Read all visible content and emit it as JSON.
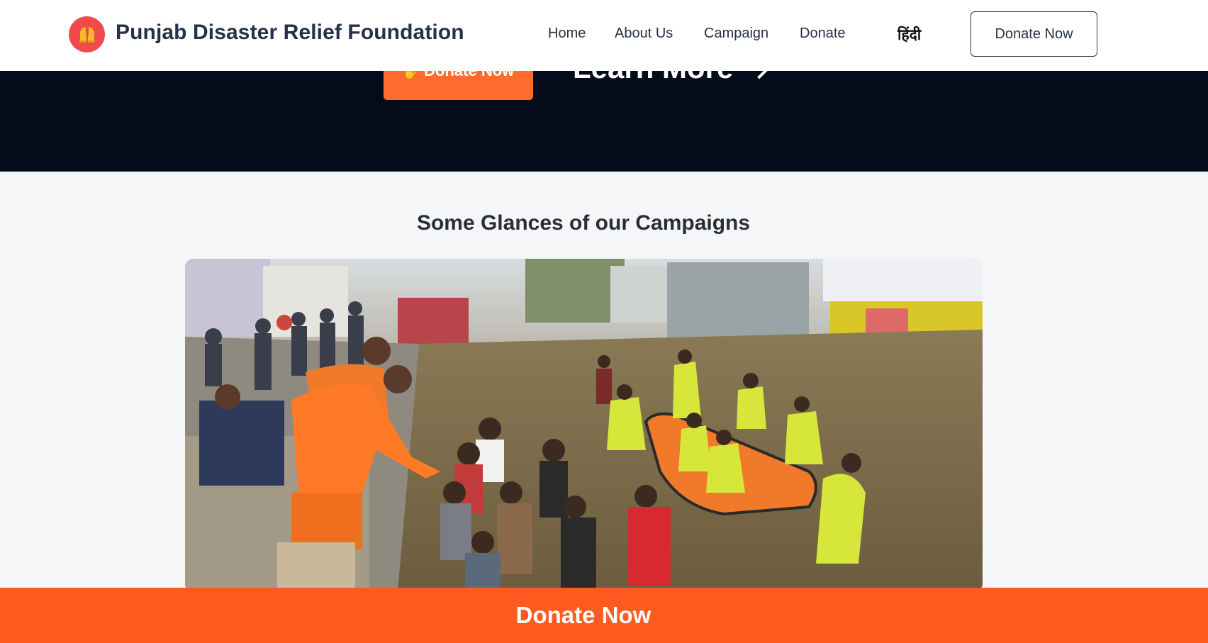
{
  "header": {
    "logo_icon": "praying-hands-icon",
    "brand": "Punjab Disaster Relief Foundation",
    "nav": [
      {
        "label": "Home"
      },
      {
        "label": "About Us"
      },
      {
        "label": "Campaign"
      },
      {
        "label": "Donate"
      }
    ],
    "language_toggle": "हिंदी",
    "donate_button": "Donate Now"
  },
  "hero": {
    "donate_button": "Donate Now",
    "learn_more": "Learn More"
  },
  "gallery": {
    "title": "Some Glances of our Campaigns",
    "photo_alt": "flood-rescue-photo"
  },
  "sticky_bar": {
    "donate_label": "Donate Now"
  },
  "colors": {
    "accent": "#ff5a1f",
    "hero_bg": "#040c1c",
    "text_dark": "#253246",
    "logo": "#f04a4a"
  }
}
